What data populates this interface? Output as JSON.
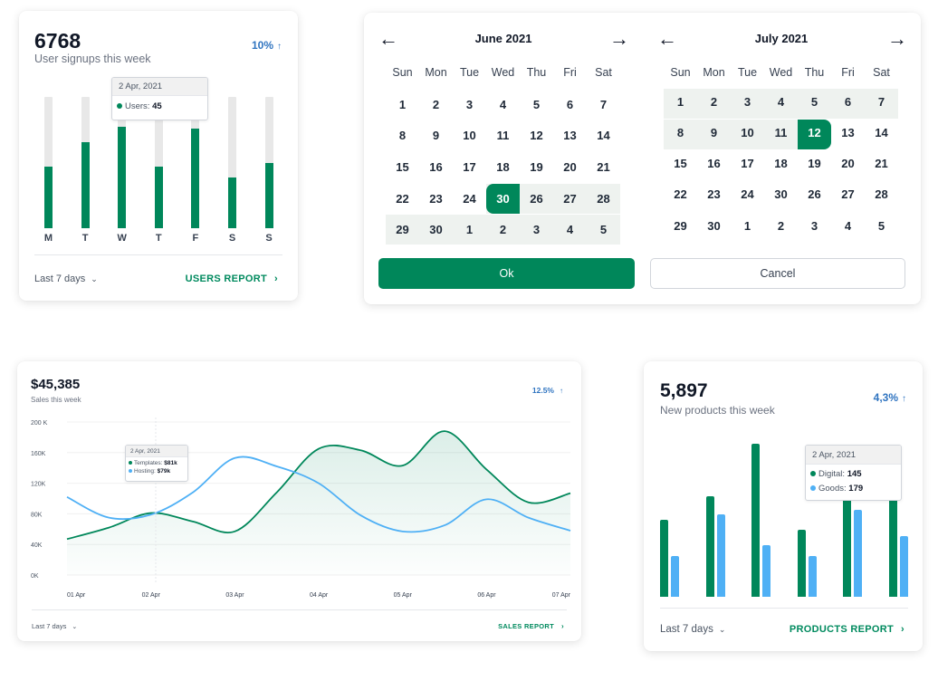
{
  "colors": {
    "green": "#00875a",
    "blue": "#4fb0f5",
    "track": "#e8e8e8",
    "link_blue": "#2f74c0"
  },
  "users_card": {
    "value": "6768",
    "subtitle": "User signups this week",
    "change": "10%",
    "footer_range": "Last 7 days",
    "footer_link": "USERS REPORT",
    "tooltip": {
      "date": "2 Apr, 2021",
      "label": "Users:",
      "value": "45"
    },
    "chart_data": {
      "type": "bar",
      "categories": [
        "M",
        "T",
        "W",
        "T",
        "F",
        "S",
        "S"
      ],
      "values": [
        45,
        63,
        74,
        45,
        73,
        37,
        48
      ],
      "ylim": [
        0,
        96
      ]
    }
  },
  "calendar": {
    "left": {
      "title": "June 2021",
      "weeks": [
        [
          "1",
          "2",
          "3",
          "4",
          "5",
          "6",
          "7"
        ],
        [
          "8",
          "9",
          "10",
          "11",
          "12",
          "13",
          "14"
        ],
        [
          "15",
          "16",
          "17",
          "18",
          "19",
          "20",
          "21"
        ],
        [
          "22",
          "23",
          "24",
          "30",
          "26",
          "27",
          "28"
        ],
        [
          "29",
          "30",
          "1",
          "2",
          "3",
          "4",
          "5"
        ]
      ]
    },
    "right": {
      "title": "July 2021",
      "weeks": [
        [
          "1",
          "2",
          "3",
          "4",
          "5",
          "6",
          "7"
        ],
        [
          "8",
          "9",
          "10",
          "11",
          "12",
          "13",
          "14"
        ],
        [
          "15",
          "16",
          "17",
          "18",
          "19",
          "20",
          "21"
        ],
        [
          "22",
          "23",
          "24",
          "30",
          "26",
          "27",
          "28"
        ],
        [
          "29",
          "30",
          "1",
          "2",
          "3",
          "4",
          "5"
        ]
      ]
    },
    "days_of_week": [
      "Sun",
      "Mon",
      "Tue",
      "Wed",
      "Thu",
      "Fri",
      "Sat"
    ],
    "ok_label": "Ok",
    "cancel_label": "Cancel"
  },
  "sales_card": {
    "value": "$45,385",
    "subtitle": "Sales this week",
    "change": "12.5%",
    "footer_range": "Last 7 days",
    "footer_link": "SALES REPORT",
    "tooltip": {
      "date": "2 Apr, 2021",
      "rows": [
        {
          "label": "Templates:",
          "value": "$81k"
        },
        {
          "label": "Hosting:",
          "value": "$79k"
        }
      ]
    },
    "chart_data": {
      "type": "line",
      "x": [
        "01 Apr",
        "",
        "02 Apr",
        "",
        "03 Apr",
        "",
        "04 Apr",
        "",
        "05 Apr",
        "",
        "06 Apr",
        "",
        "07 Apr"
      ],
      "x_tick_labels": [
        "01 Apr",
        "02 Apr",
        "03 Apr",
        "04 Apr",
        "05 Apr",
        "06 Apr",
        "07 Apr"
      ],
      "y_tick_labels": [
        "200 K",
        "160K",
        "120K",
        "80K",
        "40K",
        "0K"
      ],
      "ylim": [
        0,
        200000
      ],
      "series": [
        {
          "values": [
            47000,
            62000,
            81000,
            70000,
            57000,
            108000,
            165000,
            163000,
            143000,
            188000,
            138000,
            95000,
            107000
          ],
          "fill": true
        },
        {
          "values": [
            102000,
            75000,
            79000,
            108000,
            153000,
            142000,
            120000,
            78000,
            57000,
            65000,
            99000,
            75000,
            58000
          ],
          "fill": false
        }
      ]
    }
  },
  "products_card": {
    "value": "5,897",
    "subtitle": "New products this week",
    "change": "4,3%",
    "footer_range": "Last 7 days",
    "footer_link": "PRODUCTS REPORT",
    "tooltip": {
      "date": "2 Apr, 2021",
      "rows": [
        {
          "label": "Digital:",
          "value": "145"
        },
        {
          "label": "Goods:",
          "value": "179"
        }
      ]
    },
    "chart_data": {
      "type": "bar",
      "categories": [
        "",
        "",
        "",
        "",
        "",
        ""
      ],
      "series": [
        {
          "name": "Digital",
          "values": [
            88,
            115,
            175,
            77,
            145,
            138
          ]
        },
        {
          "name": "Goods",
          "values": [
            47,
            95,
            59,
            47,
            100,
            70
          ]
        }
      ],
      "ylim": [
        0,
        190
      ]
    }
  }
}
